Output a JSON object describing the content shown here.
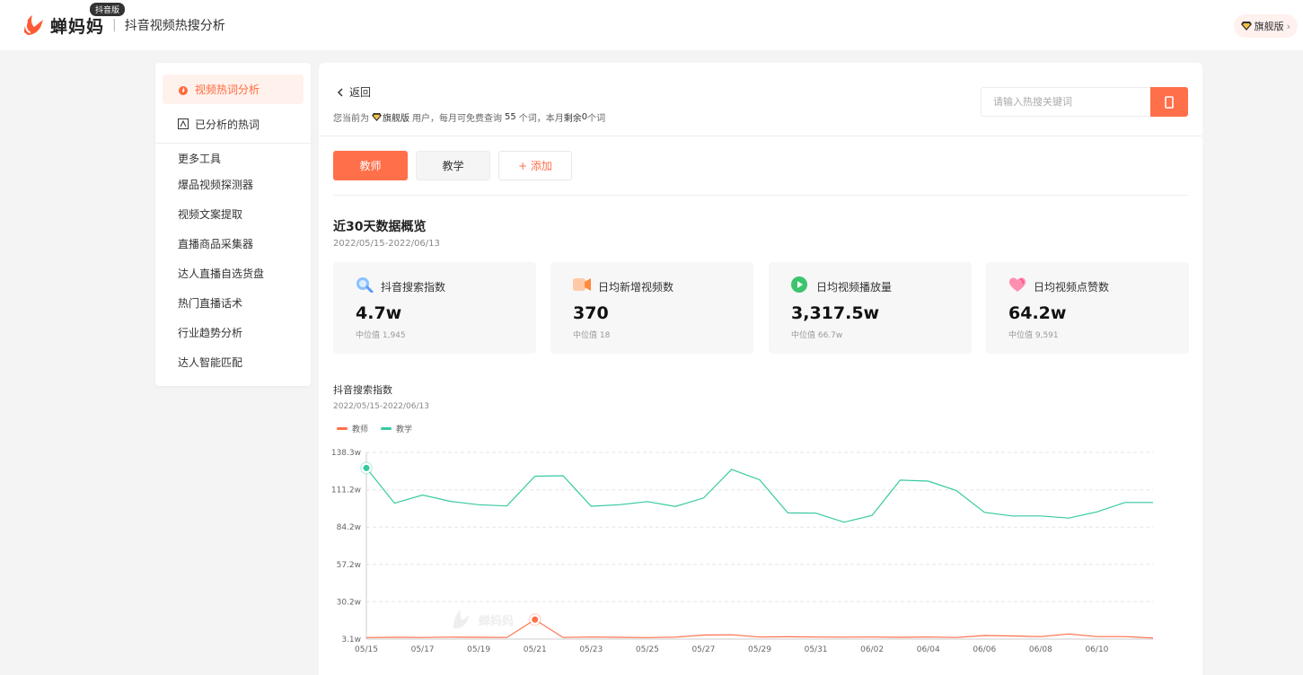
{
  "header": {
    "brand": "蝉妈妈",
    "badge": "抖音版",
    "subtitle": "抖音视频热搜分析",
    "vip_label": "旗舰版"
  },
  "sidebar": {
    "active_item": "视频热词分析",
    "item2": "已分析的热词",
    "group_label": "更多工具",
    "tools": [
      "爆品视频探测器",
      "视频文案提取",
      "直播商品采集器",
      "达人直播自选货盘",
      "热门直播话术",
      "行业趋势分析",
      "达人智能匹配"
    ]
  },
  "main": {
    "back_label": "返回",
    "quota": {
      "prefix": "您当前为",
      "plan": "旗舰版",
      "mid": "用户，每月可免费查询",
      "count": "55",
      "mid2": "个词，本月",
      "remain_label": "剩余",
      "remain": "0",
      "suffix": "个词"
    },
    "search_placeholder": "请输入热搜关键词",
    "keywords": [
      "教师",
      "教学"
    ],
    "add_label": "+ 添加",
    "overview_title": "近30天数据概览",
    "overview_date": "2022/05/15-2022/06/13",
    "cards": [
      {
        "label": "抖音搜索指数",
        "value": "4.7w",
        "median": "中位值 1,945",
        "icon": "search-magnifier-icon",
        "color": "#5b9bf5"
      },
      {
        "label": "日均新增视频数",
        "value": "370",
        "median": "中位值 18",
        "icon": "video-camera-icon",
        "color": "#ff8a3d"
      },
      {
        "label": "日均视频播放量",
        "value": "3,317.5w",
        "median": "中位值 66.7w",
        "icon": "play-icon",
        "color": "#3cc46e"
      },
      {
        "label": "日均视频点赞数",
        "value": "64.2w",
        "median": "中位值 9,591",
        "icon": "heart-icon",
        "color": "#ff6b9a"
      }
    ],
    "chart_title": "抖音搜索指数",
    "chart_date": "2022/05/15-2022/06/13",
    "watermark": "蝉妈妈"
  },
  "chart_data": {
    "type": "line",
    "title": "抖音搜索指数",
    "y_ticks": [
      "3.1w",
      "30.2w",
      "57.2w",
      "84.2w",
      "111.2w",
      "138.3w"
    ],
    "ylim": [
      3.1,
      138.3
    ],
    "x_tick_labels": [
      "05/15",
      "05/17",
      "05/19",
      "05/21",
      "05/23",
      "05/25",
      "05/27",
      "05/29",
      "05/31",
      "06/02",
      "06/04",
      "06/06",
      "06/08",
      "06/10"
    ],
    "x": [
      "05/15",
      "05/16",
      "05/17",
      "05/18",
      "05/19",
      "05/20",
      "05/21",
      "05/22",
      "05/23",
      "05/24",
      "05/25",
      "05/26",
      "05/27",
      "05/28",
      "05/29",
      "05/30",
      "05/31",
      "06/01",
      "06/02",
      "06/03",
      "06/04",
      "06/05",
      "06/06",
      "06/07",
      "06/08",
      "06/09",
      "06/10",
      "06/11",
      "06/12"
    ],
    "series": [
      {
        "name": "教师",
        "color": "#ff6f4a",
        "values": [
          4.2,
          4.4,
          4.3,
          4.5,
          4.4,
          4.3,
          17.2,
          4.3,
          4.6,
          4.4,
          4.2,
          4.5,
          6.0,
          6.2,
          4.6,
          4.8,
          4.6,
          4.5,
          4.6,
          4.4,
          4.6,
          4.3,
          5.7,
          5.4,
          4.9,
          6.8,
          4.9,
          4.9,
          3.9
        ]
      },
      {
        "name": "教学",
        "color": "#36c9a0",
        "values": [
          127.0,
          101.5,
          107.4,
          102.8,
          100.4,
          99.5,
          121.1,
          121.4,
          99.3,
          100.4,
          102.7,
          99.2,
          105.2,
          126.0,
          118.4,
          94.5,
          94.3,
          87.7,
          92.7,
          118.2,
          117.5,
          110.7,
          94.9,
          92.3,
          92.3,
          90.7,
          95.2,
          102.0,
          102.0
        ]
      }
    ],
    "markers": [
      {
        "series": "教学",
        "x": "05/15"
      },
      {
        "series": "教师",
        "x": "05/21"
      }
    ],
    "grid": true,
    "legend": "top-left"
  }
}
